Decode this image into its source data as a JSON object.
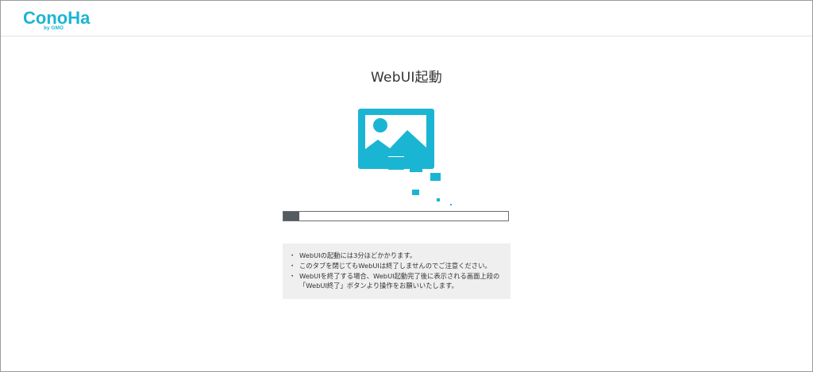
{
  "brand": {
    "name": "ConoHa",
    "sub": "by GMO",
    "color": "#1bb5d4"
  },
  "page": {
    "title": "WebUI起動"
  },
  "illustration": {
    "icon": "image-loading-icon",
    "color": "#1bb5d4"
  },
  "progress": {
    "value_percent": 7,
    "fill_color": "#555c61"
  },
  "notes": {
    "items": [
      {
        "lines": [
          "WebUIの起動には3分ほどかかります。"
        ]
      },
      {
        "lines": [
          "このタブを閉じてもWebUIは終了しませんのでご注意ください。"
        ]
      },
      {
        "lines": [
          "WebUIを終了する場合、WebUI起動完了後に表示される画面上段の",
          "「WebUI終了」ボタンより操作をお願いいたします。"
        ]
      }
    ]
  }
}
